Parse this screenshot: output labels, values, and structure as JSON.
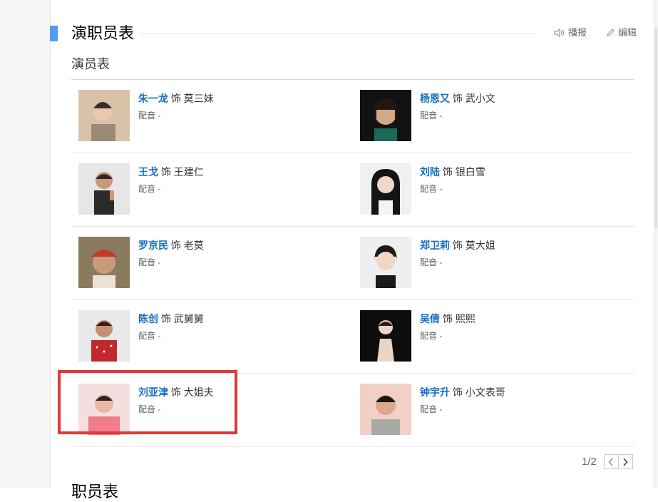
{
  "section": {
    "title": "演职员表"
  },
  "tools": {
    "report": "播报",
    "edit": "编辑"
  },
  "cast": {
    "heading": "演员表",
    "items": [
      {
        "actor": "朱一龙",
        "as": "饰",
        "role": "莫三妹",
        "dub_label": "配音",
        "dub_value": "-"
      },
      {
        "actor": "杨恩又",
        "as": "饰",
        "role": "武小文",
        "dub_label": "配音",
        "dub_value": "-"
      },
      {
        "actor": "王戈",
        "as": "饰",
        "role": "王建仁",
        "dub_label": "配音",
        "dub_value": "-"
      },
      {
        "actor": "刘陆",
        "as": "饰",
        "role": "银白雪",
        "dub_label": "配音",
        "dub_value": "-"
      },
      {
        "actor": "罗京民",
        "as": "饰",
        "role": "老莫",
        "dub_label": "配音",
        "dub_value": "-"
      },
      {
        "actor": "郑卫莉",
        "as": "饰",
        "role": "莫大姐",
        "dub_label": "配音",
        "dub_value": "-"
      },
      {
        "actor": "陈创",
        "as": "饰",
        "role": "武舅舅",
        "dub_label": "配音",
        "dub_value": "-"
      },
      {
        "actor": "吴倩",
        "as": "饰",
        "role": "熙熙",
        "dub_label": "配音",
        "dub_value": "-"
      },
      {
        "actor": "刘亚津",
        "as": "饰",
        "role": "大姐夫",
        "dub_label": "配音",
        "dub_value": "-"
      },
      {
        "actor": "钟宇升",
        "as": "饰",
        "role": "小文表哥",
        "dub_label": "配音",
        "dub_value": "-"
      }
    ]
  },
  "pager": {
    "text": "1/2"
  },
  "next_section": {
    "title": "职员表"
  },
  "colors": {
    "accent": "#4f9cee",
    "link": "#136ec2",
    "highlight": "#e3373a"
  },
  "icons": {
    "report": "speaker-icon",
    "edit": "pencil-icon",
    "prev": "chevron-left-icon",
    "next": "chevron-right-icon"
  }
}
